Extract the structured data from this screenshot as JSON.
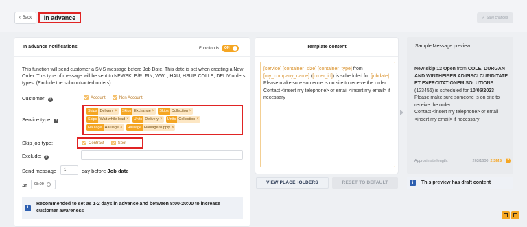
{
  "header": {
    "back_label": "Back",
    "title": "In advance",
    "save_label": "Save changes"
  },
  "left": {
    "title": "In advance notifications",
    "function_label": "Function is",
    "toggle_label": "ON",
    "description": "This function will send customer a SMS message before Job Date. This date is set when creating a New Order. This type of message will be sent to NEWSK, E/R, FIN, WWL, HAU, HSUP, COLLE, DELIV orders types. (Exclude the subcontracted orders)",
    "customer_label": "Customer:",
    "customer_options": [
      "Account",
      "Non Account"
    ],
    "service_label": "Service type:",
    "service_chips": [
      {
        "type": "Skips",
        "value": "Delivery"
      },
      {
        "type": "Skips",
        "value": "Exchange"
      },
      {
        "type": "Skips",
        "value": "Collection"
      },
      {
        "type": "Skips",
        "value": "Wait while load"
      },
      {
        "type": "Units",
        "value": "Delivery"
      },
      {
        "type": "Units",
        "value": "Collection"
      },
      {
        "type": "Haulage",
        "value": "Haulage"
      },
      {
        "type": "Haulage",
        "value": "Haulage supply"
      }
    ],
    "skip_label": "Skip job type:",
    "skip_options": [
      "Contract",
      "Spot"
    ],
    "exclude_label": "Exclude:",
    "send_label": "Send message",
    "send_days": "1",
    "send_suffix": "day before",
    "send_suffix_bold": "Job date",
    "at_label": "At",
    "at_time": "08:00",
    "recommend": "Recommended to set as 1-2 days in advance and between 8:00-20:00 to increase customer awareness"
  },
  "template": {
    "title": "Template content",
    "ph_service": "[service]",
    "ph_size": "[container_size]",
    "ph_ctype": "[container_type]",
    "from": "from",
    "ph_company": "[my_company_name]",
    "paren_open": "(",
    "ph_order": "[order_id]",
    "paren_close": ")",
    "sched": "is scheduled for",
    "ph_jobdate": "[jobdate]",
    "line_site": "Please make sure someone is on site to receive the order.",
    "line_contact": "Contact <insert my telephone> or email <insert my email> if necessary",
    "view_btn": "VIEW PLACEHOLDERS",
    "reset_btn": "RESET TO DEFAULT"
  },
  "preview": {
    "title": "Sample Message preview",
    "bold1": "New skip 12 Open",
    "from": "from",
    "bold2": "COLE, DURGAN AND WINTHEISER ADIPISCI CUPIDITATE ET EXERCITATIONEM SOLUTIONS",
    "order": "(123456)",
    "sched": "is scheduled for",
    "date": "10/05/2023",
    "line_site": "Please make sure someone is on site to receive the order.",
    "line_contact": "Contact <insert my telephone> or email <insert my email> if necessary",
    "length_label": "Approximate length:",
    "length_value": "263/1600",
    "sms_count": "2 SMS",
    "draft_note": "This preview has draft content"
  },
  "colors": {
    "accent": "#f5a623",
    "highlight_border": "#e02424",
    "info_blue": "#2d5fb0"
  }
}
